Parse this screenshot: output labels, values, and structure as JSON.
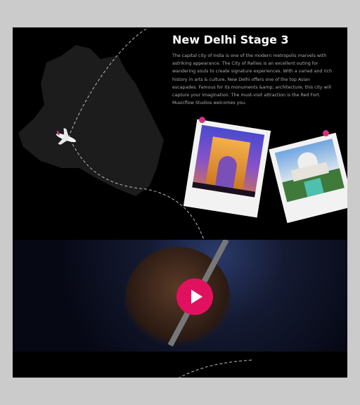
{
  "stage": {
    "title": "New Delhi Stage 3",
    "description": [
      "The capital city of India is one of the modern metropolis marvels with",
      "astriking appearance. The City of Rallies is an excellent outing for",
      "wandering souls to create signature experiences. With a varied and rich",
      "history in arts & culture, New Delhi offers one of the top Asian",
      "escapades. Famous for its monuments &amp; architecture, this city will",
      "capture your imagination. The must-visit attraction is the Red Fort.",
      "Musicflow Studios welcomes you."
    ]
  },
  "photos": [
    {
      "subject": "India Gate"
    },
    {
      "subject": "Taj Mahal"
    }
  ],
  "video": {
    "play_icon": "play-icon"
  },
  "colors": {
    "accent": "#e2115f",
    "pin": "#d0337a",
    "map": "#1c1c1c"
  }
}
